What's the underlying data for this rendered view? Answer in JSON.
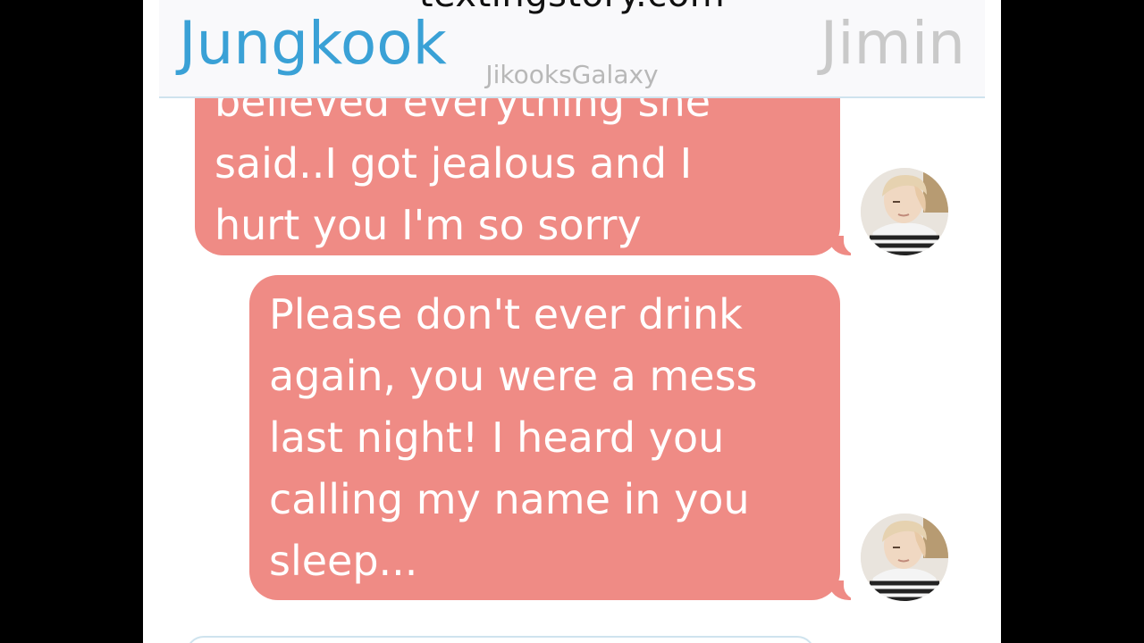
{
  "header": {
    "watermark_top": "textingstory.com",
    "contact_left": "Jungkook",
    "contact_right": "Jimin",
    "brand": "JikooksGalaxy"
  },
  "messages": [
    {
      "sender": "Jimin",
      "lines": [
        "believed everything she",
        "said..I got jealous and I",
        "hurt you I'm so sorry"
      ],
      "avatar_icon": "profile-photo-icon"
    },
    {
      "sender": "Jimin",
      "lines": [
        "Please don't ever drink",
        "again, you were a mess",
        "last night! I heard you",
        "calling my name in you",
        "sleep..."
      ],
      "avatar_icon": "profile-photo-icon"
    }
  ],
  "colors": {
    "background": "#000000",
    "chat_background": "#ffffff",
    "bubble": "#ef8b85",
    "bubble_text": "#ffffff",
    "contact_active": "#3aa1d6",
    "contact_inactive": "#c9c9c9"
  }
}
